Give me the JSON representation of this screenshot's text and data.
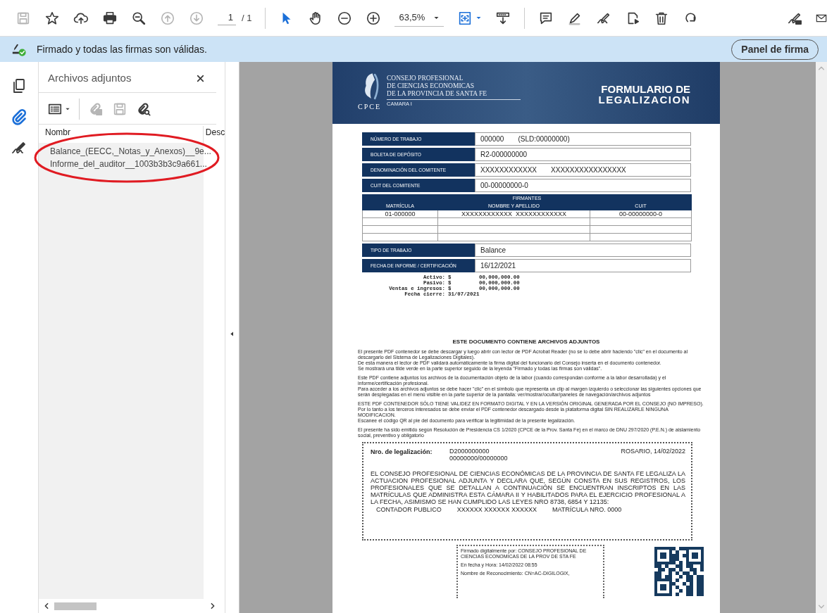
{
  "toolbar": {
    "file_tools": [
      {
        "disabled": true
      },
      {
        "disabled": false
      },
      {
        "disabled": false
      },
      {
        "disabled": false
      },
      {
        "disabled": false
      },
      {
        "disabled": true
      },
      {
        "disabled": true
      }
    ],
    "page_number": "1",
    "page_count": "/ 1",
    "mode_tools": [
      {
        "selected": true
      },
      {
        "selected": false
      }
    ],
    "zoom_level": "63,5%"
  },
  "signature_bar": {
    "valid": true,
    "message": "Firmado y todas las firmas son válidas.",
    "button": "Panel de firma"
  },
  "side_rail": [
    {
      "selected": false
    },
    {
      "selected": true
    },
    {
      "selected": false
    }
  ],
  "attachments_panel": {
    "title": "Archivos adjuntos",
    "tools": [
      {
        "disabled": false
      },
      {
        "disabled": true
      },
      {
        "disabled": true
      },
      {
        "disabled": false
      }
    ],
    "columns": [
      "Nombr",
      "Desc"
    ],
    "files": [
      "Balance_(EECC,_Notas_y_Anexos)__9e...",
      "Informe_del_auditor__1003b3b3c9a661..."
    ]
  },
  "document": {
    "header": {
      "logo_text": "CPCE",
      "org_lines": [
        "CONSEJO PROFESIONAL",
        "DE CIENCIAS ECONOMICAS",
        "DE LA PROVINCIA DE SANTA FE",
        "CAMARA I"
      ],
      "title_lines": [
        "FORMULARIO DE",
        "LEGALIZACION"
      ]
    },
    "fields_top": [
      {
        "label": "NÚMERO DE TRABAJO",
        "values": [
          "000000",
          "(SLD:00000000)"
        ]
      },
      {
        "label": "BOLETA DE DEPÓSITO",
        "values": [
          "R2-000000000"
        ]
      },
      {
        "label": "DENOMINACIÓN DEL COMITENTE",
        "values": [
          "XXXXXXXXXXXX",
          "XXXXXXXXXXXXXXXX"
        ]
      },
      {
        "label": "CUIT DEL COMITENTE",
        "values": [
          "00-00000000-0"
        ]
      }
    ],
    "signers": {
      "title": "FIRMANTES",
      "columns": [
        "MATRÍCULA",
        "NOMBRE Y APELLIDO",
        "CUIT"
      ],
      "rows": [
        [
          "01-000000",
          "XXXXXXXXXXXX  XXXXXXXXXXXX",
          "00-00000000-0"
        ]
      ]
    },
    "fields_bottom": [
      {
        "label": "TIPO DE TRABAJO",
        "values": [
          "Balance"
        ]
      },
      {
        "label": "FECHA DE INFORME / CERTIFICACIÓN",
        "values": [
          "16/12/2021"
        ]
      }
    ],
    "summary": [
      {
        "label": "Activo:",
        "currency": "$",
        "amount": "00,000,000.00"
      },
      {
        "label": "Pasivo:",
        "currency": "$",
        "amount": "00,000,000.00"
      },
      {
        "label": "Ventas e ingresos:",
        "currency": "$",
        "amount": "00,000,000.00"
      },
      {
        "label": "Fecha cierre:",
        "amount": "31/07/2021"
      }
    ],
    "notice_title": "ESTE DOCUMENTO CONTIENE ARCHIVOS ADJUNTOS",
    "notice_paragraphs": [
      [
        "El presente PDF contenedor se debe descargar y luego abrir con lector de PDF Acrobat Reader (no se lo debe abrir haciendo \"clic\" en el documento al descargarlo del Sistema de Legalizaciones Digitales).",
        "De esta manera el lector de PDF validará automáticamente la firma digital del funcionario del Consejo inserta en el documento contenedor.",
        "Se mostrará una tilde verde en la parte superior seguido de la leyenda \"Firmado y todas las firmas son válidas\"."
      ],
      [
        "Este PDF contiene adjuntos los archivos de la documentación objeto de la labor (cuando correspondan conforme a la labor desarrollada) y el informe/certificación profesional.",
        "Para acceder a los archivos adjuntos se debe hacer \"clic\" en el símbolo que representa un clip al margen izquierdo o seleccionar las siguientes opciones que serán desplegadas en el menú visible en la parte superior de la pantalla: ver/mostrar/ocultar/paneles de navegación/archivos adjuntos"
      ],
      [
        "ESTE PDF CONTENEDOR SÓLO TIENE VALIDEZ EN FORMATO DIGITAL Y EN LA VERSIÓN ORIGINAL GENERADA POR EL CONSEJO (NO IMPRESO).",
        "Por lo tanto a los terceros interesados se debe enviar el PDF contenedor descargado desde la plataforma digital SIN REALIZARLE NINGUNA MODIFICACION.",
        "Escanee el código QR al pie del documento para verificar la legitimidad de la presente legalización."
      ],
      [
        "El presente ha sido emitido según Resolución de Presidencia CS 1/2020 (CPCE de la Prov. Santa Fe) en el marco de DNU 297/2020 (P.E.N.) de aislamiento social, preventivo y obligatorio"
      ]
    ],
    "legalization": {
      "label": "Nro. de legalización:",
      "numbers": [
        "D2000000000",
        "00000000/00000000"
      ],
      "place_date": "ROSARIO, 14/02/2022",
      "statement": "EL CONSEJO PROFESIONAL DE CIENCIAS ECONÓMICAS DE LA PROVINCIA DE SANTA FE LEGALIZA LA ACTUACION PROFESIONAL ADJUNTA Y DECLARA QUE, SEGÚN CONSTA EN SUS REGISTROS, LOS PROFESIONALES QUE SE DETALLAN A CONTINUACIÓN SE ENCUENTRAN INSCRIPTOS EN LAS MATRÍCULAS QUE ADMINISTRA ESTA CÁMARA II Y HABILITADOS PARA EL EJERCICIO PROFESIONAL A LA FECHA, ASIMISMO SE HAN CUMPLIDO LAS LEYES NRO 8738, 6854 Y 12135:",
      "professional": [
        "CONTADOR PUBLICO",
        "XXXXXX XXXXXX XXXXXX",
        "MATRÍCULA NRO. 0000"
      ]
    },
    "digital_signature": [
      "Firmado digitalmente por: CONSEJO PROFESIONAL DE CIENCIAS ECONOMICAS DE LA PROV DE STA FE",
      "En fecha y Hora: 14/02/2022 08:55",
      "Nombre de Reconocimiento: CN=AC-DIGILOGIX,"
    ]
  }
}
